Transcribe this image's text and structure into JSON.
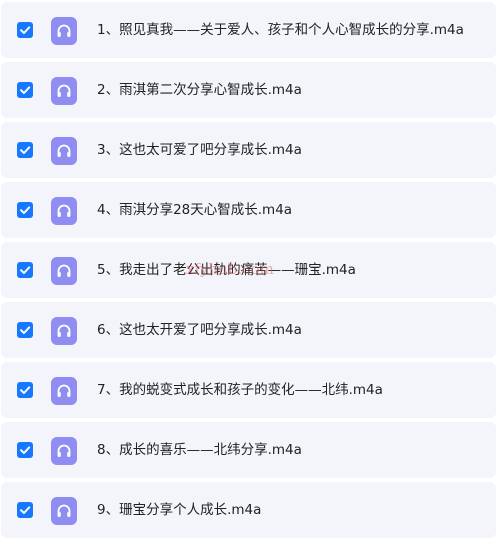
{
  "files": [
    {
      "name": "1、照见真我——关于爱人、孩子和个人心智成长的分享.m4a",
      "checked": true,
      "icon": "headphones-icon"
    },
    {
      "name": "2、雨淇第二次分享心智成长.m4a",
      "checked": true,
      "icon": "headphones-icon"
    },
    {
      "name": "3、这也太可爱了吧分享成长.m4a",
      "checked": true,
      "icon": "headphones-icon"
    },
    {
      "name": "4、雨淇分享28天心智成长.m4a",
      "checked": true,
      "icon": "headphones-icon"
    },
    {
      "name": "5、我走出了老公出轨的痛苦——珊宝.m4a",
      "checked": true,
      "icon": "headphones-icon"
    },
    {
      "name": "6、这也太开爱了吧分享成长.m4a",
      "checked": true,
      "icon": "headphones-icon"
    },
    {
      "name": "7、我的蜕变式成长和孩子的变化——北纬.m4a",
      "checked": true,
      "icon": "headphones-icon"
    },
    {
      "name": "8、成长的喜乐——北纬分享.m4a",
      "checked": true,
      "icon": "headphones-icon"
    },
    {
      "name": "9、珊宝分享个人成长.m4a",
      "checked": true,
      "icon": "headphones-icon"
    }
  ],
  "watermark": "xfyhub.com",
  "colors": {
    "row_background": "#f4f5fb",
    "checkbox": "#1677ff",
    "audio_icon": "#8f8df2",
    "text": "#222222",
    "watermark": "#e06666"
  }
}
